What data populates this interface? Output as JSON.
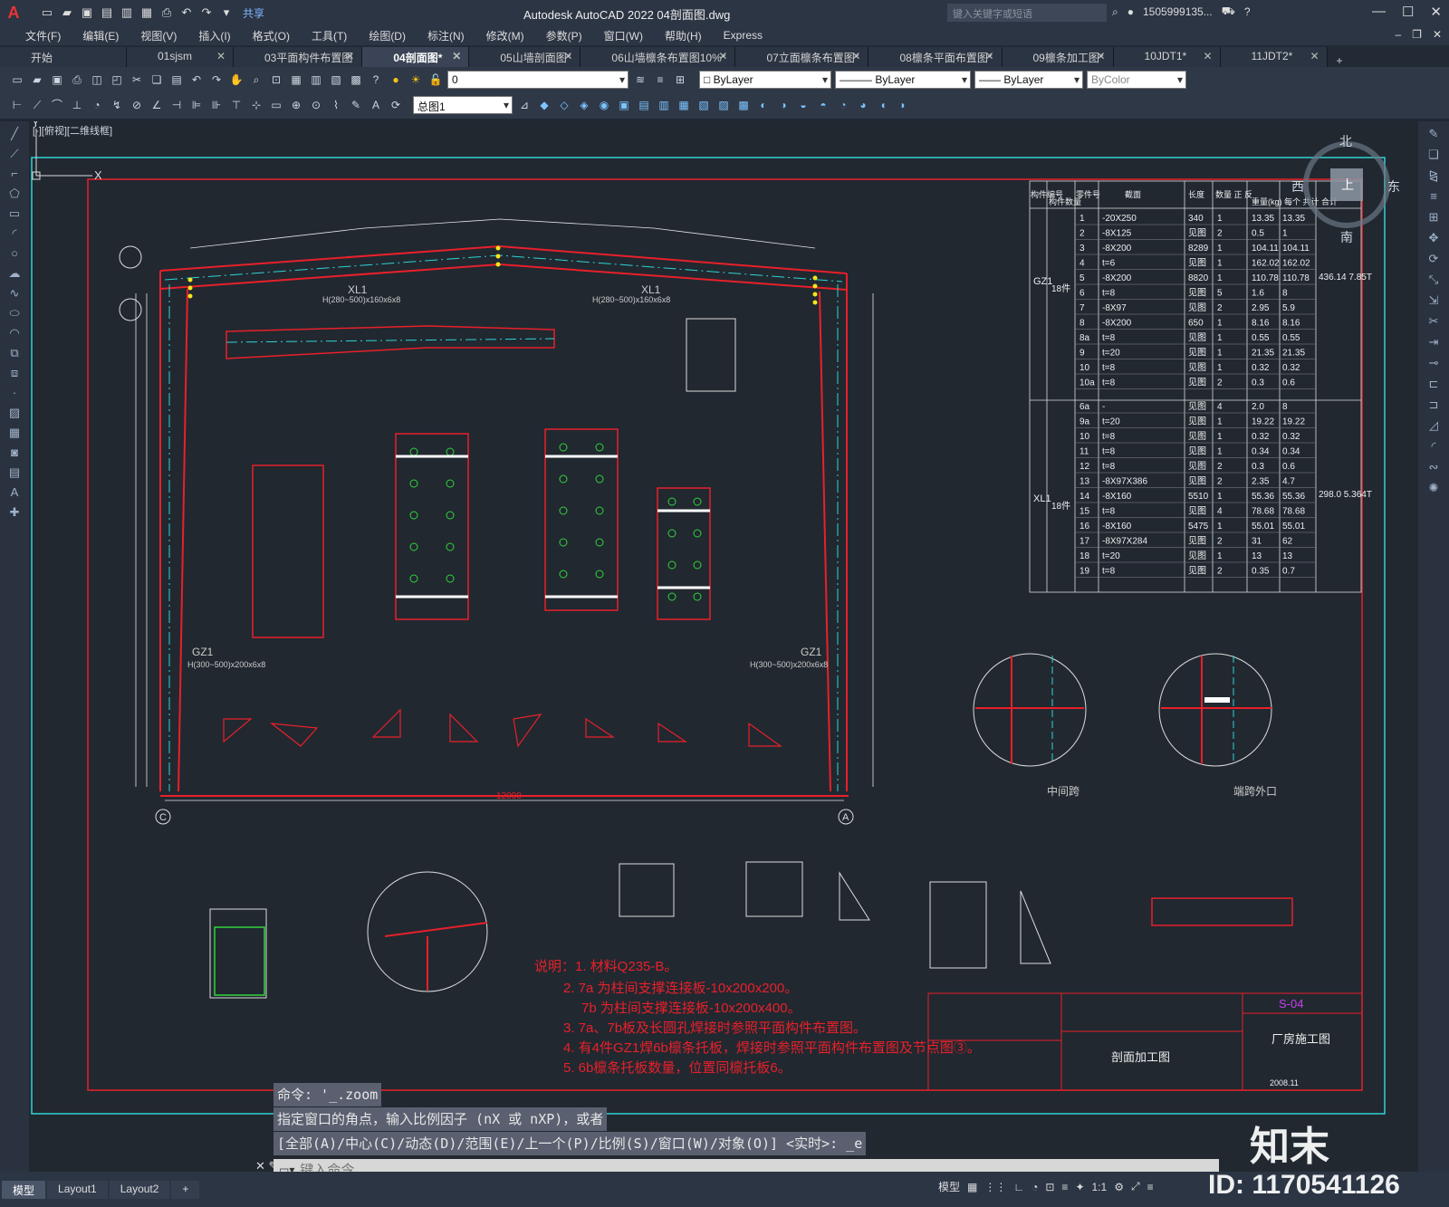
{
  "app": {
    "title": "Autodesk AutoCAD 2022    04剖面图.dwg",
    "share_label": "共享",
    "search_placeholder": "键入关键字或短语",
    "user": "1505999135...",
    "logo": "A"
  },
  "menu": [
    "文件(F)",
    "编辑(E)",
    "视图(V)",
    "插入(I)",
    "格式(O)",
    "工具(T)",
    "绘图(D)",
    "标注(N)",
    "修改(M)",
    "参数(P)",
    "窗口(W)",
    "帮助(H)",
    "Express"
  ],
  "tabs": [
    {
      "label": "开始",
      "active": false
    },
    {
      "label": "01sjsm",
      "active": false
    },
    {
      "label": "03平面构件布置图",
      "active": false
    },
    {
      "label": "04剖面图*",
      "active": true
    },
    {
      "label": "05山墙剖面图*",
      "active": false
    },
    {
      "label": "06山墙檩条布置图10%*",
      "active": false
    },
    {
      "label": "07立面檩条布置图*",
      "active": false
    },
    {
      "label": "08檩条平面布置图*",
      "active": false
    },
    {
      "label": "09檩条加工图*",
      "active": false
    },
    {
      "label": "10JDT1*",
      "active": false
    },
    {
      "label": "11JDT2*",
      "active": false
    }
  ],
  "toolbar": {
    "layer": "0",
    "color": "ByLayer",
    "linetype": "ByLayer",
    "lineweight": "ByLayer",
    "plotstyle": "ByColor",
    "layout_select": "总图1"
  },
  "viewport_label": "[-][俯视][二维线框]",
  "compass": {
    "north": "北",
    "south": "南",
    "east": "东",
    "west": "西",
    "center": "上"
  },
  "drawing": {
    "notes": [
      "说明：1. 材料Q235-B。",
      "2. 7a 为柱间支撑连接板-10x200x200。",
      "7b 为柱间支撑连接板-10x200x400。",
      "3. 7a、7b板及长圆孔焊接时参照平面构件布置图。",
      "4. 有4件GZ1焊6b檩条托板，焊接时参照平面构件布置图及节点图③。",
      "5. 6b檩条托板数量，位置同檩托板6。"
    ],
    "title_block": {
      "code": "S-04",
      "project": "厂房施工图",
      "drawing_name": "剖面加工图",
      "date": "2008.11"
    },
    "span_label": "12000",
    "axis_left": "C",
    "axis_right": "A",
    "section_labels": [
      "中间跨",
      "端跨外口"
    ],
    "member_labels": [
      "GZ1",
      "GZ1",
      "XL1",
      "XL1"
    ],
    "member_specs": [
      "H(300~500)x200x6x8",
      "H(300~500)x200x6x8",
      "H(280~500)x160x6x8",
      "H(280~500)x160x6x8"
    ]
  },
  "bom": {
    "headers": [
      "构件编号",
      "构件数量",
      "零件号",
      "截面",
      "长度",
      "数量 正 反",
      "重量(kg) 每个 共计 合计"
    ],
    "groups": [
      {
        "name": "GZ1",
        "qty": "18件",
        "total": "436.14 7.85T",
        "rows": [
          [
            "1",
            "-20X250",
            "340",
            "1",
            "13.35",
            "13.35"
          ],
          [
            "2",
            "-8X125",
            "见图",
            "2",
            "0.5",
            "1"
          ],
          [
            "3",
            "-8X200",
            "8289",
            "1",
            "104.11",
            "104.11"
          ],
          [
            "4",
            "t=6",
            "见图",
            "1",
            "162.02",
            "162.02"
          ],
          [
            "5",
            "-8X200",
            "8820",
            "1",
            "110.78",
            "110.78"
          ],
          [
            "6",
            "t=8",
            "见图",
            "5",
            "1.6",
            "8"
          ],
          [
            "7",
            "-8X97",
            "见图",
            "2",
            "2.95",
            "5.9"
          ],
          [
            "8",
            "-8X200",
            "650",
            "1",
            "8.16",
            "8.16"
          ],
          [
            "8a",
            "t=8",
            "见图",
            "1",
            "0.55",
            "0.55"
          ],
          [
            "9",
            "t=20",
            "见图",
            "1",
            "21.35",
            "21.35"
          ],
          [
            "10",
            "t=8",
            "见图",
            "1",
            "0.32",
            "0.32"
          ],
          [
            "10a",
            "t=8",
            "见图",
            "2",
            "0.3",
            "0.6"
          ]
        ]
      },
      {
        "name": "XL1",
        "qty": "18件",
        "total": "298.0 5.364T",
        "rows": [
          [
            "6a",
            "-",
            "见图",
            "4",
            "2.0",
            "8"
          ],
          [
            "9a",
            "t=20",
            "见图",
            "1",
            "19.22",
            "19.22"
          ],
          [
            "10",
            "t=8",
            "见图",
            "1",
            "0.32",
            "0.32"
          ],
          [
            "11",
            "t=8",
            "见图",
            "1",
            "0.34",
            "0.34"
          ],
          [
            "12",
            "t=8",
            "见图",
            "2",
            "0.3",
            "0.6"
          ],
          [
            "13",
            "-8X97X386",
            "见图",
            "2",
            "2.35",
            "4.7"
          ],
          [
            "14",
            "-8X160",
            "5510",
            "1",
            "55.36",
            "55.36"
          ],
          [
            "15",
            "t=8",
            "见图",
            "4",
            "78.68",
            "78.68"
          ],
          [
            "16",
            "-8X160",
            "5475",
            "1",
            "55.01",
            "55.01"
          ],
          [
            "17",
            "-8X97X284",
            "见图",
            "2",
            "31",
            "62"
          ],
          [
            "18",
            "t=20",
            "见图",
            "1",
            "13",
            "13"
          ],
          [
            "19",
            "t=8",
            "见图",
            "2",
            "0.35",
            "0.7"
          ]
        ]
      }
    ]
  },
  "command": {
    "history": [
      "命令: '_.zoom",
      "指定窗口的角点，输入比例因子 (nX 或 nXP)，或者",
      "[全部(A)/中心(C)/动态(D)/范围(E)/上一个(P)/比例(S)/窗口(W)/对象(O)] <实时>: _e"
    ],
    "placeholder": "键入命令"
  },
  "layout_tabs": [
    "模型",
    "Layout1",
    "Layout2"
  ],
  "status": {
    "mode": "模型",
    "scale": "1:1"
  },
  "watermark": {
    "id": "ID: 1170541126",
    "brand": "知末"
  }
}
